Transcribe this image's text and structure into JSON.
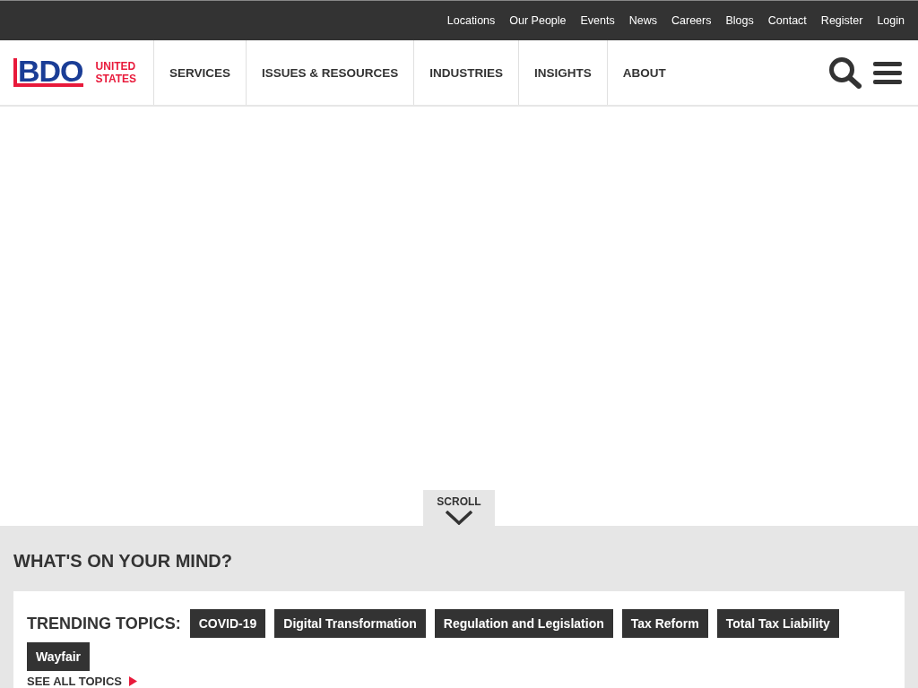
{
  "utility_nav": [
    "Locations",
    "Our People",
    "Events",
    "News",
    "Careers",
    "Blogs",
    "Contact",
    "Register",
    "Login"
  ],
  "logo": {
    "mark": "BDO",
    "region": "UNITED STATES"
  },
  "main_nav": [
    "SERVICES",
    "ISSUES & RESOURCES",
    "INDUSTRIES",
    "INSIGHTS",
    "ABOUT"
  ],
  "scroll": {
    "label": "SCROLL"
  },
  "mind": {
    "heading": "WHAT'S ON YOUR MIND?",
    "trending_label": "TRENDING TOPICS:",
    "topics": [
      "COVID-19",
      "Digital Transformation",
      "Regulation and Legislation",
      "Tax Reform",
      "Total Tax Liability",
      "Wayfair"
    ],
    "see_all": "SEE ALL TOPICS"
  }
}
